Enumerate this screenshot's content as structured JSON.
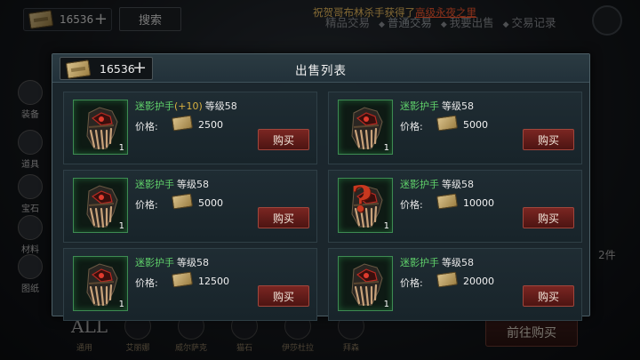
{
  "top_bar": {
    "currency_value": "16536",
    "currency_plus": "+",
    "search_label": "搜索",
    "announcement_prefix": "祝贺哥布林杀手获得了",
    "announcement_item": "高级永夜之里",
    "tabs": [
      "精品交易",
      "普通交易",
      "我要出售",
      "交易记录"
    ]
  },
  "side_nav": {
    "items": [
      {
        "label": "装备"
      },
      {
        "label": "道具"
      },
      {
        "label": "宝石"
      },
      {
        "label": "材料"
      },
      {
        "label": "图纸"
      }
    ]
  },
  "bottom_bar": {
    "items": [
      {
        "icon": "ALL",
        "label": "通用"
      },
      {
        "icon": "",
        "label": "艾丽娜"
      },
      {
        "icon": "",
        "label": "威尔萨克"
      },
      {
        "icon": "",
        "label": "猫石"
      },
      {
        "icon": "",
        "label": "伊莎杜拉"
      },
      {
        "icon": "",
        "label": "拜森"
      }
    ]
  },
  "background": {
    "goto_buy_label": "前往购买",
    "count_label": "2件"
  },
  "modal": {
    "title": "出售列表",
    "currency_value": "16536",
    "currency_plus": "+",
    "price_label": "价格:",
    "buy_label": "购买",
    "listings": [
      {
        "name": "迷影护手",
        "enhance": "(+10)",
        "level": "等级58",
        "price": "2500",
        "qty": "1",
        "icon": "gauntlet-icon"
      },
      {
        "name": "迷影护手",
        "enhance": "",
        "level": "等级58",
        "price": "5000",
        "qty": "1",
        "icon": "gauntlet-icon"
      },
      {
        "name": "迷影护手",
        "enhance": "",
        "level": "等级58",
        "price": "5000",
        "qty": "1",
        "icon": "gauntlet-icon"
      },
      {
        "name": "迷影护手",
        "enhance": "",
        "level": "等级58",
        "price": "10000",
        "qty": "1",
        "icon": "unknown-question-icon"
      },
      {
        "name": "迷影护手",
        "enhance": "",
        "level": "等级58",
        "price": "12500",
        "qty": "1",
        "icon": "gauntlet-icon"
      },
      {
        "name": "迷影护手",
        "enhance": "",
        "level": "等级58",
        "price": "20000",
        "qty": "1",
        "icon": "gauntlet-icon"
      }
    ]
  }
}
